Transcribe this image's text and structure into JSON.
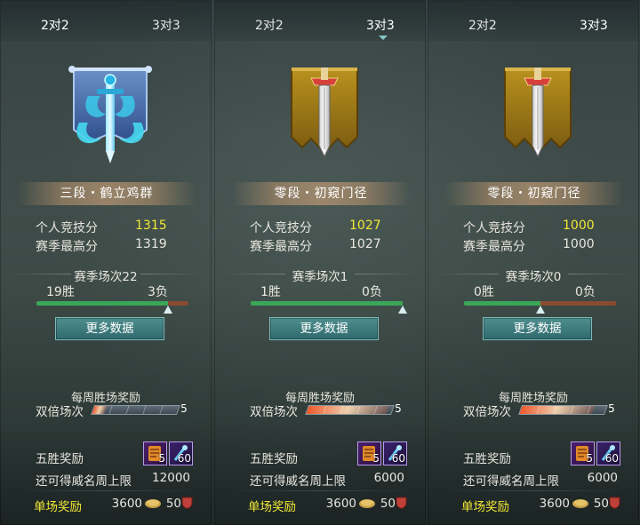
{
  "colors": {
    "score_highlight": "#f1e836",
    "win_bar": "#3aa657",
    "loss_bar": "#8a4b30",
    "button": "#2f6a6e"
  },
  "panels": [
    {
      "tabs": [
        "2对2",
        "3对3"
      ],
      "active_tab": 0,
      "emblem": "blue-dragon-banner-icon",
      "rank": "三段・鹤立鸡群",
      "personal_label": "个人竞技分",
      "personal_score": "1315",
      "season_high_label": "赛季最高分",
      "season_high": "1319",
      "season_matches": "赛季场次22",
      "wins": "19胜",
      "losses": "3负",
      "win_ratio": 0.864,
      "more_button": "更多数据",
      "weekly_title": "每周胜场奖励",
      "double_label": "双倍场次",
      "double_progress": 0.15,
      "double_count": "5",
      "five_win_label": "五胜奖励",
      "reward_items": [
        {
          "icon": "scroll-item-icon",
          "qty": "5"
        },
        {
          "icon": "feather-item-icon",
          "qty": "60"
        }
      ],
      "cap_label": "还可得威名周上限",
      "cap_value": "12000",
      "single_label": "单场奖励",
      "single_coins": "3600",
      "single_honor": "50"
    },
    {
      "tabs": [
        "2对2",
        "3对3"
      ],
      "active_tab": 1,
      "emblem": "golden-sword-banner-icon",
      "rank": "零段・初窥门径",
      "personal_label": "个人竞技分",
      "personal_score": "1027",
      "season_high_label": "赛季最高分",
      "season_high": "1027",
      "season_matches": "赛季场次1",
      "wins": "1胜",
      "losses": "0负",
      "win_ratio": 1.0,
      "more_button": "更多数据",
      "weekly_title": "每周胜场奖励",
      "double_label": "双倍场次",
      "double_progress": 0.95,
      "double_count": "5",
      "five_win_label": "五胜奖励",
      "reward_items": [
        {
          "icon": "scroll-item-icon",
          "qty": "5"
        },
        {
          "icon": "feather-item-icon",
          "qty": "60"
        }
      ],
      "cap_label": "还可得威名周上限",
      "cap_value": "6000",
      "single_label": "单场奖励",
      "single_coins": "3600",
      "single_honor": "50"
    },
    {
      "tabs": [
        "2对2",
        "3对3"
      ],
      "active_tab": 1,
      "emblem": "golden-sword-banner-icon",
      "rank": "零段・初窥门径",
      "personal_label": "个人竞技分",
      "personal_score": "1000",
      "season_high_label": "赛季最高分",
      "season_high": "1000",
      "season_matches": "赛季场次0",
      "wins": "0胜",
      "losses": "0负",
      "win_ratio": 0.5,
      "more_button": "更多数据",
      "weekly_title": "每周胜场奖励",
      "double_label": "双倍场次",
      "double_progress": 0.85,
      "double_count": "5",
      "five_win_label": "五胜奖励",
      "reward_items": [
        {
          "icon": "scroll-item-icon",
          "qty": "5"
        },
        {
          "icon": "feather-item-icon",
          "qty": "60"
        }
      ],
      "cap_label": "还可得威名周上限",
      "cap_value": "6000",
      "single_label": "单场奖励",
      "single_coins": "3600",
      "single_honor": "50"
    }
  ]
}
